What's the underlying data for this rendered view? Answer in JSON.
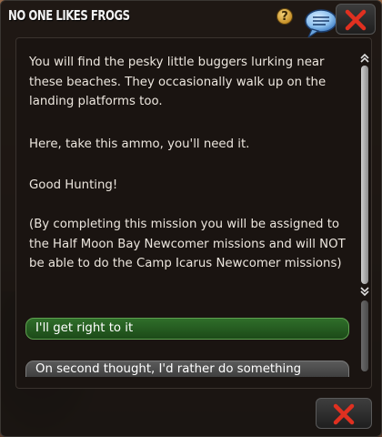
{
  "window": {
    "title": "NO ONE LIKES FROGS"
  },
  "icons": {
    "help": "help-icon",
    "help_glyph": "?",
    "chat": "speech-bubble-icon",
    "close": "close-icon",
    "close_color": "#e03020"
  },
  "dialog": {
    "paragraphs": [
      "You will find the pesky little buggers lurking near these beaches. They occasionally walk up on the landing platforms too.",
      "Here, take this ammo, you'll need it.",
      "Good Hunting!",
      "(By completing this mission you will be assigned to the Half Moon Bay Newcomer missions and will NOT be able to do the Camp Icarus Newcomer missions)"
    ]
  },
  "choices": [
    {
      "label": "I'll get right to it",
      "color": "#2f6e2a"
    },
    {
      "label": "On second thought, I'd rather do something",
      "color": "#5a5a5a"
    }
  ]
}
